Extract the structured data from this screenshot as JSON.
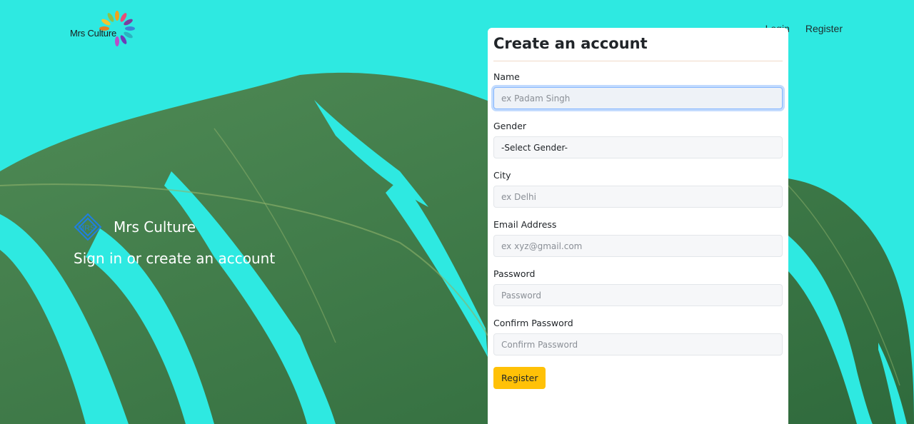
{
  "header": {
    "logo_text": "Mrs Culture",
    "nav": [
      {
        "label": "Login"
      },
      {
        "label": "Register"
      }
    ]
  },
  "hero": {
    "brand_name": "Mrs Culture",
    "tagline": "Sign in or create an account"
  },
  "form": {
    "title": "Create an account",
    "fields": {
      "name": {
        "label": "Name",
        "placeholder": "ex Padam Singh"
      },
      "gender": {
        "label": "Gender",
        "selected": "-Select Gender-"
      },
      "city": {
        "label": "City",
        "placeholder": "ex Delhi"
      },
      "email": {
        "label": "Email Address",
        "placeholder": "ex xyz@gmail.com"
      },
      "password": {
        "label": "Password",
        "placeholder": "Password"
      },
      "confirm_password": {
        "label": "Confirm Password",
        "placeholder": "Confirm Password"
      }
    },
    "submit_label": "Register"
  },
  "colors": {
    "background": "#2ee9e1",
    "leaf": "#3f7a4a",
    "button": "#ffc107",
    "focus_ring": "#86b7fe"
  }
}
